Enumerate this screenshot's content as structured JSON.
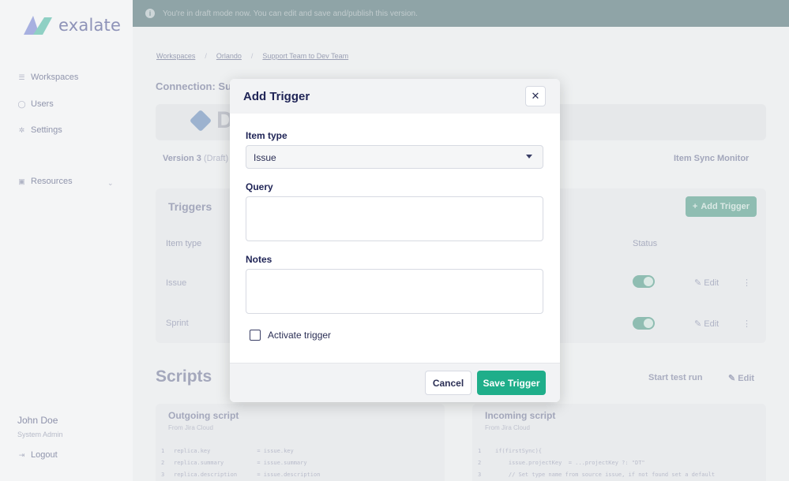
{
  "app": {
    "logo_text": "exalate"
  },
  "sidebar": {
    "items": [
      {
        "label": "Workspaces",
        "icon": "list-icon"
      },
      {
        "label": "Users",
        "icon": "user-icon"
      },
      {
        "label": "Settings",
        "icon": "gear-icon"
      },
      {
        "label": "Resources",
        "icon": "book-icon"
      }
    ],
    "user": {
      "name": "John Doe",
      "role": "System Admin"
    },
    "logout_label": "Logout"
  },
  "banner": {
    "text": "You're in draft mode now. You can edit and save and/publish this version."
  },
  "breadcrumb": [
    "Workspaces",
    "Orlando",
    "Support Team to Dev Team"
  ],
  "connection": {
    "title": "Connection: Sup",
    "version_label": "Version 3",
    "version_state": "(Draft)",
    "sync_monitor_label": "Item Sync Monitor"
  },
  "triggers": {
    "title": "Triggers",
    "add_label": "Add Trigger",
    "columns": {
      "item_type": "Item type",
      "status": "Status"
    },
    "rows": [
      {
        "item_type": "Issue",
        "edit": "Edit",
        "active": true
      },
      {
        "item_type": "Sprint",
        "edit": "Edit",
        "active": true
      }
    ]
  },
  "scripts": {
    "title": "Scripts",
    "start_test_label": "Start test run",
    "edit_label": "Edit",
    "outgoing": {
      "title": "Outgoing script",
      "subtitle": "From Jira Cloud",
      "lines": [
        {
          "n": "1",
          "text": "replica.key              = issue.key"
        },
        {
          "n": "2",
          "text": "replica.summary          = issue.summary"
        },
        {
          "n": "3",
          "text": "replica.description      = issue.description"
        }
      ]
    },
    "incoming": {
      "title": "Incoming script",
      "subtitle": "From Jira Cloud",
      "lines": [
        {
          "n": "1",
          "text": "if(firstSync){"
        },
        {
          "n": "2",
          "text": "    issue.projectKey  = ...projectKey ?: \"DT\""
        },
        {
          "n": "3",
          "text": "    // Set type name from source issue, if not found set a default"
        }
      ]
    }
  },
  "modal": {
    "title": "Add Trigger",
    "item_type_label": "Item type",
    "item_type_value": "Issue",
    "query_label": "Query",
    "query_value": "",
    "notes_label": "Notes",
    "notes_value": "",
    "activate_label": "Activate trigger",
    "cancel_label": "Cancel",
    "save_label": "Save Trigger"
  },
  "colors": {
    "accent": "#1fae8a",
    "primary_text": "#1f2456",
    "banner": "#8fa4a7"
  }
}
